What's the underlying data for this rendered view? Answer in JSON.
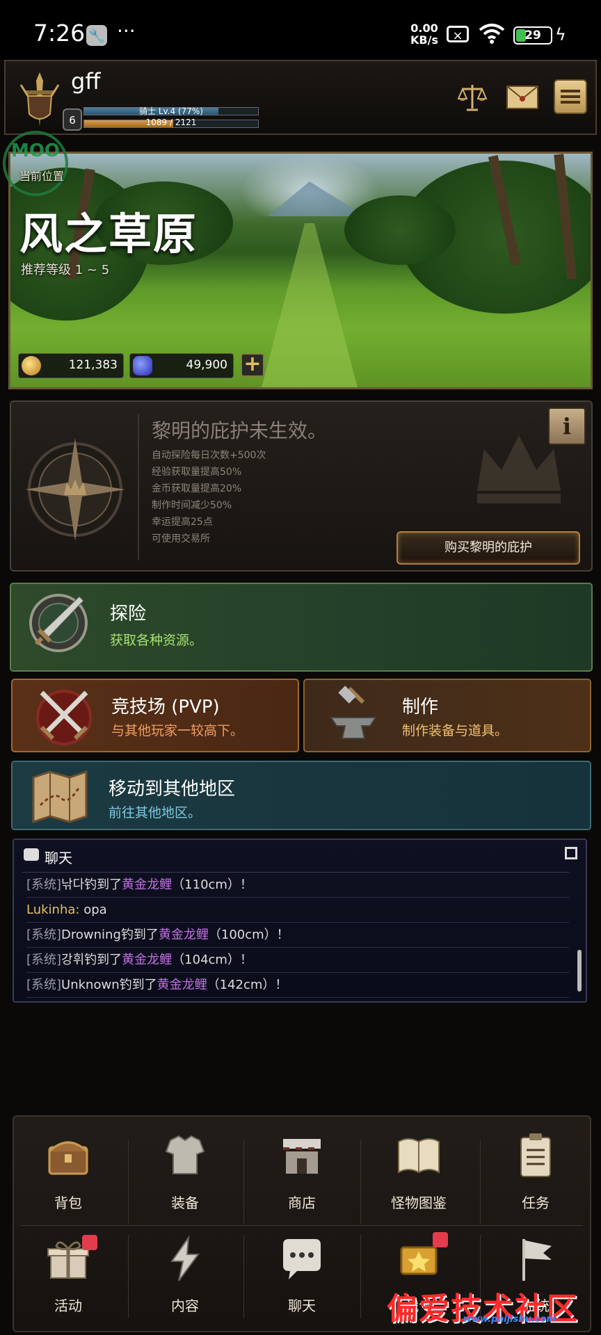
{
  "status_bar": {
    "time": "7:26",
    "net_speed_value": "0.00",
    "net_speed_unit": "KB/s",
    "battery_percent": 29,
    "battery_label": "29"
  },
  "player": {
    "name": "gff",
    "level_badge": "6",
    "xp_text": "骑士 Lv.4 (77%)",
    "xp_percent": 77,
    "hp_text": "1089 / 2121",
    "hp_current": 1089,
    "hp_max": 2121
  },
  "watermark": {
    "top_logo": "MOO",
    "bottom_site": "偏爱技术社区",
    "bottom_url": "www.paijishu.com"
  },
  "location": {
    "current_label": "当前位置",
    "name": "风之草原",
    "recommended_level": "推荐等级 1 ~ 5",
    "gold": "121,383",
    "gems": "49,900",
    "add_button": "+"
  },
  "dawn": {
    "title": "黎明的庇护未生效。",
    "perks": [
      "自动探险每日次数+500次",
      "经验获取量提高50%",
      "金币获取量提高20%",
      "制作时间减少50%",
      "幸运提高25点",
      "可使用交易所"
    ],
    "info_button": "i",
    "buy_button": "购买黎明的庇护"
  },
  "actions": {
    "adventure": {
      "title": "探险",
      "desc": "获取各种资源。"
    },
    "pvp": {
      "title": "竞技场 (PVP)",
      "desc": "与其他玩家一较高下。"
    },
    "craft": {
      "title": "制作",
      "desc": "制作装备与道具。"
    },
    "travel": {
      "title": "移动到其他地区",
      "desc": "前往其他地区。"
    }
  },
  "chat": {
    "title": "聊天",
    "messages": [
      {
        "prefix": "[系统]",
        "user": "낚다",
        "action": "钓到了",
        "item": "黄金龙鲤",
        "size": "（110cm）！"
      },
      {
        "prefix": "",
        "user": "Lukinha:",
        "action": " opa",
        "item": "",
        "size": ""
      },
      {
        "prefix": "[系统]",
        "user": "Drowning",
        "action": "钓到了",
        "item": "黄金龙鲤",
        "size": "（100cm）！"
      },
      {
        "prefix": "[系统]",
        "user": "강휘",
        "action": "钓到了",
        "item": "黄金龙鲤",
        "size": "（104cm）！"
      },
      {
        "prefix": "[系统]",
        "user": "Unknown",
        "action": "钓到了",
        "item": "黄金龙鲤",
        "size": "（142cm）！"
      }
    ]
  },
  "nav": {
    "row1": [
      "背包",
      "装备",
      "商店",
      "怪物图鉴",
      "任务"
    ],
    "row2": [
      "活动",
      "内容",
      "聊天",
      "战令",
      "血统"
    ]
  },
  "colors": {
    "accent_gold": "#b08040",
    "adventure_green": "#2e4a2a",
    "pvp_orange": "#5a3018",
    "travel_teal": "#1c3a42",
    "chat_item_purple": "#c070e0",
    "badge_red": "#e33c4c"
  }
}
